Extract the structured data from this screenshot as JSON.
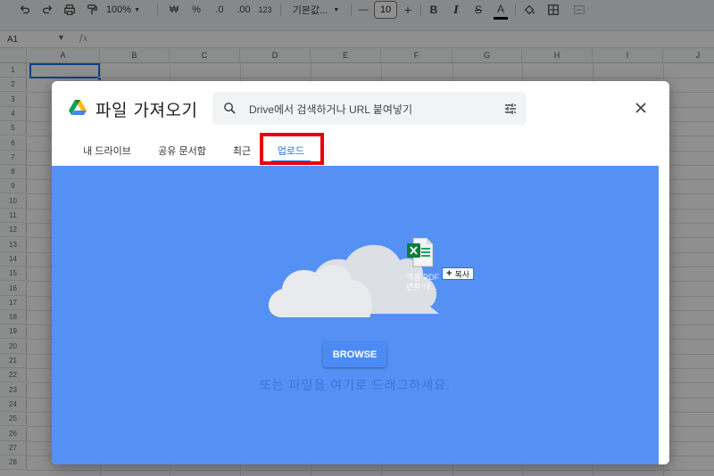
{
  "toolbar": {
    "zoom": "100%",
    "currency": "₩",
    "percent": "%",
    "dec_decrease": ".0",
    "dec_increase": ".00",
    "number_format": "123",
    "font_name": "기본값...",
    "minus": "—",
    "font_size": "10",
    "plus": "+",
    "bold": "B",
    "italic": "I",
    "strike": "S",
    "text_color": "A"
  },
  "formula_bar": {
    "name_box": "A1",
    "fx": "fx"
  },
  "sheet": {
    "columns": [
      "A",
      "B",
      "C",
      "D",
      "E",
      "F",
      "G",
      "H",
      "I",
      "J"
    ],
    "rows": [
      "1",
      "2",
      "3",
      "4",
      "5",
      "6",
      "7",
      "8",
      "9",
      "10",
      "11",
      "12",
      "13",
      "14",
      "15",
      "16",
      "17",
      "18",
      "19",
      "20",
      "21",
      "22",
      "23",
      "24",
      "25",
      "26",
      "27",
      "28"
    ]
  },
  "dialog": {
    "title": "파일 가져오기",
    "search_placeholder": "Drive에서 검색하거나 URL 붙여넣기",
    "tabs": [
      {
        "label": "내 드라이브"
      },
      {
        "label": "공유 문서함"
      },
      {
        "label": "최근"
      },
      {
        "label": "업로드"
      }
    ],
    "active_tab": "업로드",
    "upload": {
      "file_name": "엑셀 PDF 변환 테...",
      "copy_badge": "복사",
      "copy_plus": "+",
      "browse_label": "BROWSE",
      "drop_text": "또는 파일을 여기로 드래그하세요."
    }
  },
  "colors": {
    "accent": "#1a73e8",
    "upload_bg": "#5591f5",
    "highlight": "#e8000b"
  }
}
